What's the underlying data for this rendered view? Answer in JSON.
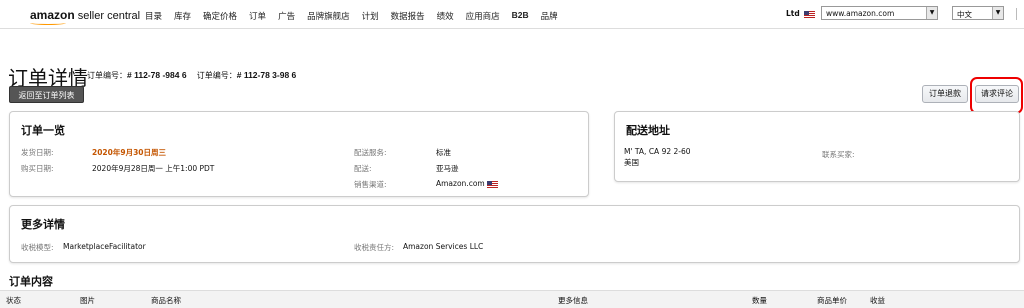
{
  "brand": {
    "logo_main": "amazon",
    "logo_sub": "seller central"
  },
  "nav": {
    "items": [
      "目录",
      "库存",
      "确定价格",
      "订单",
      "广告",
      "品牌旗舰店",
      "计划",
      "数据报告",
      "绩效",
      "应用商店",
      "B2B",
      "品牌"
    ]
  },
  "header_right": {
    "region": "Ltd",
    "marketplace": "www.amazon.com",
    "language": "中文"
  },
  "page": {
    "title": "订单详情",
    "order_label_1": "订单编号：",
    "order_id_1": "# 112-78      -984   6",
    "order_label_2": "订单编号：",
    "order_id_2": "# 112-78      3-98     6",
    "back_button": "返回至订单列表",
    "refund_button": "订单退款",
    "review_button": "请求评论"
  },
  "overview": {
    "heading": "订单一览",
    "ship_date_label": "发货日期:",
    "ship_date_value": "2020年9月30日周三",
    "purchase_date_label": "购买日期:",
    "purchase_date_value": "2020年9月28日周一 上午1:00 PDT",
    "shipping_service_label": "配送服务:",
    "shipping_service_value": "标准",
    "fulfillment_label": "配送:",
    "fulfillment_value": "亚马逊",
    "sales_channel_label": "销售渠道:",
    "sales_channel_value": "Amazon.com"
  },
  "address": {
    "heading": "配送地址",
    "line1": "M'       TA, CA 92     2-60",
    "line2": "美国",
    "contact_buyer": "联系买家:"
  },
  "details": {
    "heading": "更多详情",
    "tax_model_label": "收税模型:",
    "tax_model_value": "MarketplaceFacilitator",
    "tax_responsible_label": "收税责任方:",
    "tax_responsible_value": "Amazon Services LLC"
  },
  "order_content": {
    "heading": "订单内容",
    "columns": [
      "状态",
      "图片",
      "商品名称",
      "更多信息",
      "数量",
      "商品单价",
      "收益"
    ]
  },
  "colors": {
    "orange_date": "#c45500",
    "highlight": "#e00000",
    "accent_smile": "#ff9900"
  }
}
